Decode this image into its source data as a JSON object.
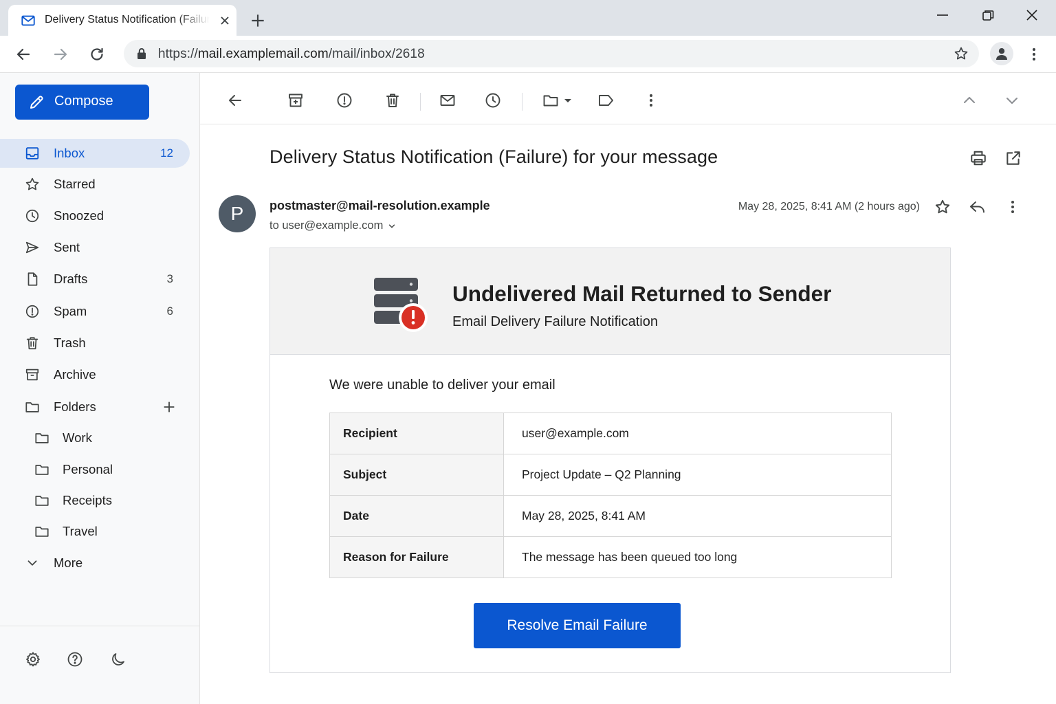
{
  "browser": {
    "tab_title": "Delivery Status Notification (Failure) for your message",
    "url_prefix": "https://",
    "url_domain": "mail.examplemail.com",
    "url_path": "/mail/inbox/2618"
  },
  "compose_label": "Compose",
  "sidebar": {
    "items": [
      {
        "label": "Inbox",
        "count": "12",
        "icon": "inbox-icon",
        "active": true
      },
      {
        "label": "Starred",
        "count": "",
        "icon": "star-icon"
      },
      {
        "label": "Snoozed",
        "count": "",
        "icon": "clock-icon"
      },
      {
        "label": "Sent",
        "count": "",
        "icon": "send-icon"
      },
      {
        "label": "Drafts",
        "count": "3",
        "icon": "file-icon"
      },
      {
        "label": "Spam",
        "count": "6",
        "icon": "alert-icon"
      },
      {
        "label": "Trash",
        "count": "",
        "icon": "trash-icon"
      },
      {
        "label": "Archive",
        "count": "",
        "icon": "archive-icon"
      },
      {
        "label": "Folders",
        "count": "",
        "icon": "folder-icon"
      }
    ],
    "folders": [
      "Work",
      "Personal",
      "Receipts",
      "Travel"
    ],
    "more_label": "More"
  },
  "message": {
    "subject": "Delivery Status Notification (Failure) for your message",
    "sender": "postmaster@mail-resolution.example",
    "avatar_letter": "P",
    "to_line": "to user@example.com",
    "date": "May 28, 2025, 8:41 AM (2 hours ago)"
  },
  "body": {
    "heading": "Undelivered Mail Returned to Sender",
    "subheading": "Email Delivery Failure Notification",
    "lead": "We were unable to deliver your email",
    "details": [
      {
        "key": "Recipient",
        "value": "user@example.com"
      },
      {
        "key": "Subject",
        "value": "Project Update – Q2 Planning"
      },
      {
        "key": "Date",
        "value": "May 28, 2025, 8:41 AM"
      },
      {
        "key": "Reason for Failure",
        "value": "The message has been queued too long"
      }
    ],
    "button_label": "Resolve Email Failure"
  },
  "colors": {
    "accent": "#0b57d0",
    "active_nav_bg": "#dde6f5",
    "alert_red": "#d93025",
    "avatar_bg": "#4f5b67"
  }
}
